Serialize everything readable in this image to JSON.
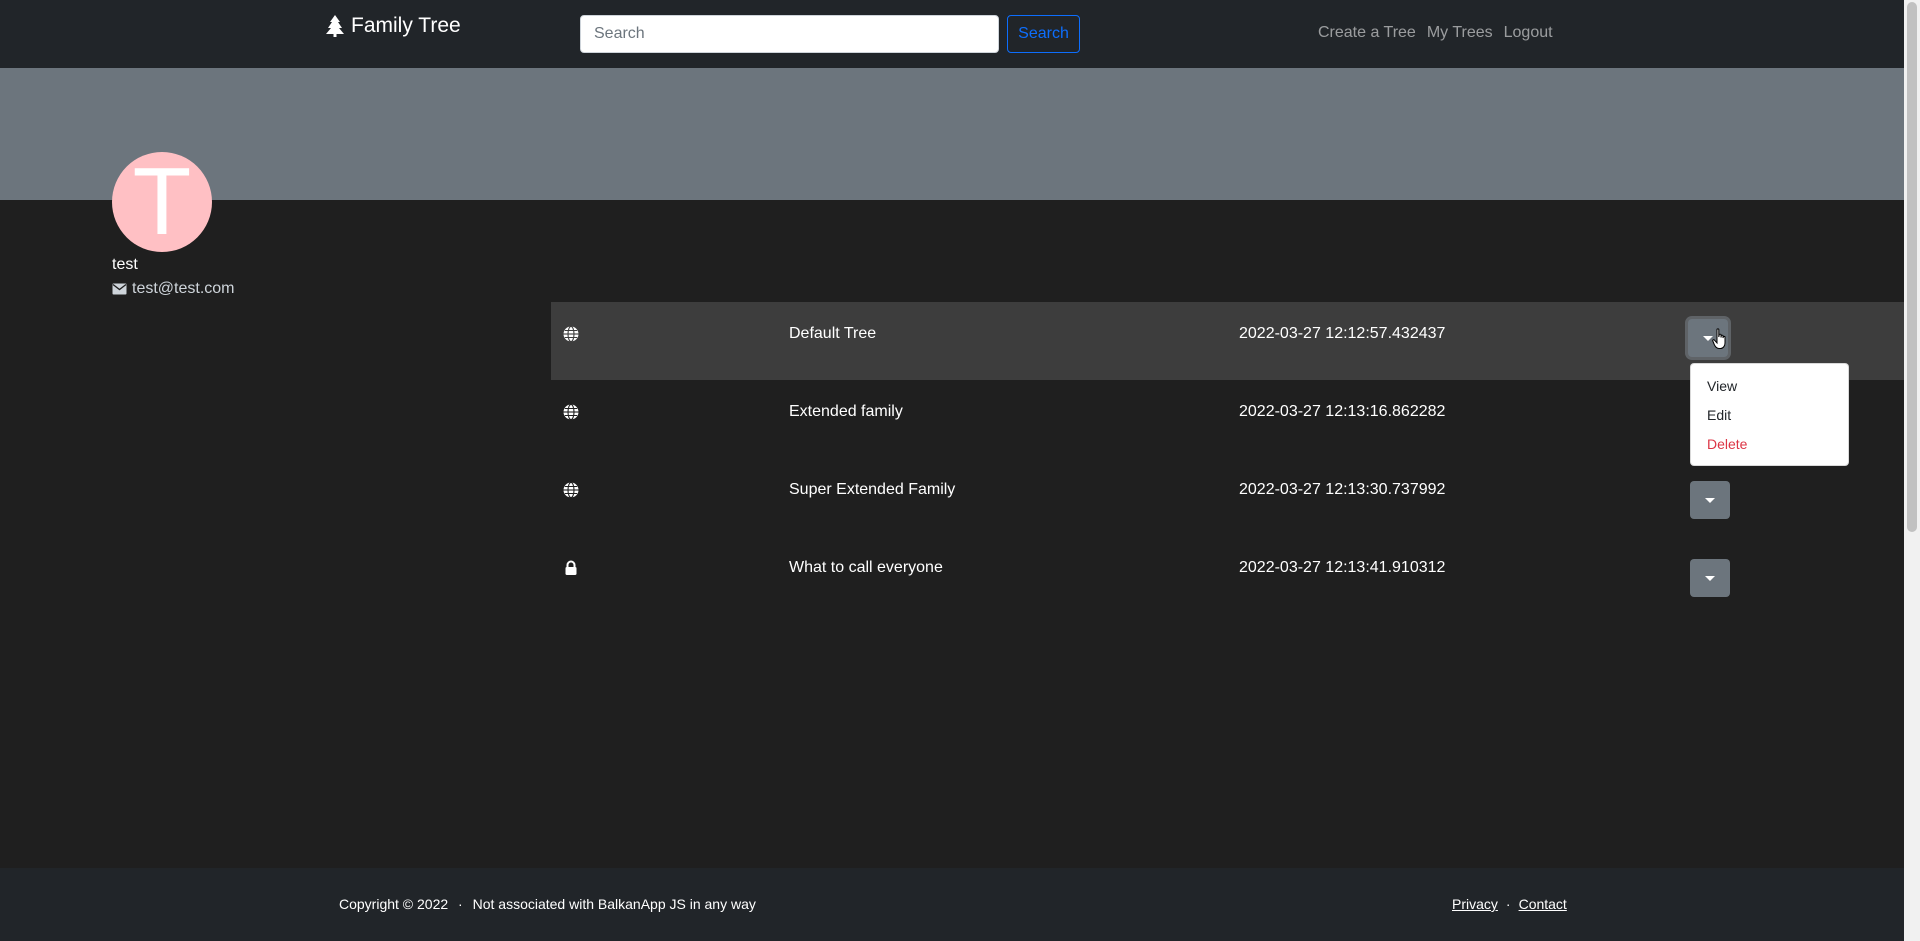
{
  "navbar": {
    "brand": "Family Tree",
    "search_placeholder": "Search",
    "search_button": "Search",
    "links": [
      "Create a Tree",
      "My Trees",
      "Logout"
    ]
  },
  "profile": {
    "avatar_letter": "T",
    "username": "test",
    "email": "test@test.com",
    "avatar_color": "#ffc0c4"
  },
  "trees": [
    {
      "visibility": "globe-icon",
      "name": "Default Tree",
      "date": "2022-03-27 12:12:57.432437"
    },
    {
      "visibility": "globe-icon",
      "name": "Extended family",
      "date": "2022-03-27 12:13:16.862282"
    },
    {
      "visibility": "globe-icon",
      "name": "Super Extended Family",
      "date": "2022-03-27 12:13:30.737992"
    },
    {
      "visibility": "lock-icon",
      "name": "What to call everyone",
      "date": "2022-03-27 12:13:41.910312"
    }
  ],
  "dropdown": {
    "items": [
      "View",
      "Edit",
      "Delete"
    ]
  },
  "footer": {
    "copyright": "Copyright © 2022",
    "note": "Not associated with BalkanApp JS in any way",
    "separator": "·",
    "links": [
      "Privacy",
      "Contact"
    ]
  },
  "colors": {
    "navbar_bg": "#212529",
    "banner_bg": "#6c757d",
    "page_bg": "#1f1f1f",
    "primary": "#0d6efd",
    "danger": "#dc3545"
  }
}
